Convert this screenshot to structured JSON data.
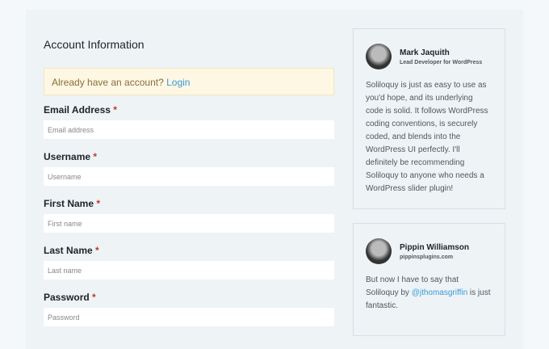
{
  "form": {
    "title": "Account Information",
    "notice": "Already have an account?",
    "login": "Login",
    "required_mark": "*",
    "fields": [
      {
        "label": "Email Address",
        "placeholder": "Email address"
      },
      {
        "label": "Username",
        "placeholder": "Username"
      },
      {
        "label": "First Name",
        "placeholder": "First name"
      },
      {
        "label": "Last Name",
        "placeholder": "Last name"
      },
      {
        "label": "Password",
        "placeholder": "Password"
      }
    ]
  },
  "testimonials": [
    {
      "name": "Mark Jaquith",
      "subtitle": "Lead Developer for WordPress",
      "quote": "Soliloquy is just as easy to use as you'd hope, and its underlying code is solid. It follows WordPress coding conventions, is securely coded, and blends into the WordPress UI perfectly. I'll definitely be recommending Soliloquy to anyone who needs a WordPress slider plugin!"
    },
    {
      "name": "Pippin Williamson",
      "subtitle": "pippinsplugins.com",
      "quote_before": "But now I have to say that Soliloquy by ",
      "mention": "@jthomasgriffin",
      "quote_after": " is just fantastic."
    }
  ]
}
